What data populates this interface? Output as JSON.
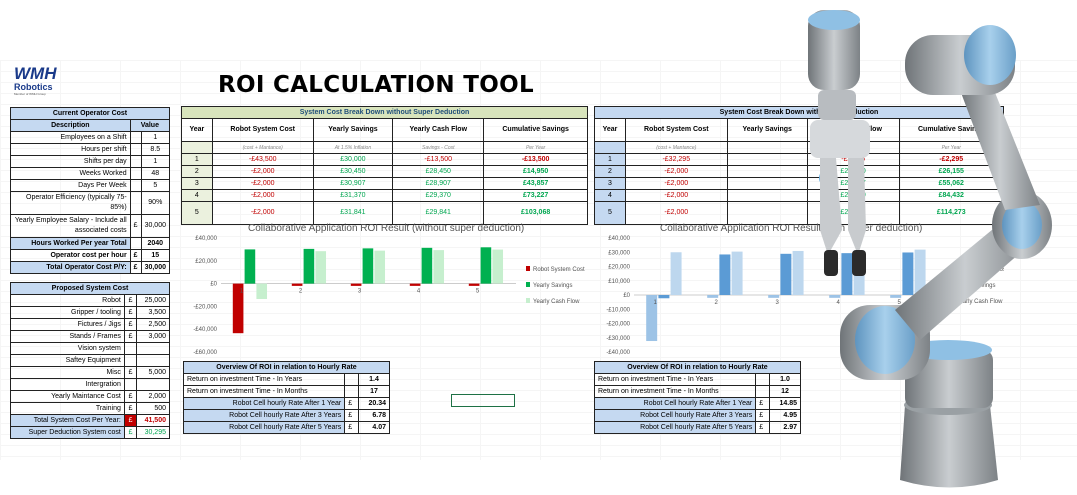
{
  "page_title": "ROI CALCULATION TOOL",
  "logo": {
    "text": "WMH",
    "sub": "Robotics",
    "tag": "Member of WMH Group"
  },
  "operator": {
    "header": "Current Operator Cost",
    "col_desc": "Description",
    "col_val": "Value",
    "rows": [
      {
        "label": "Employees on a Shift",
        "cur": "",
        "value": "1"
      },
      {
        "label": "Hours per shift",
        "cur": "",
        "value": "8.5"
      },
      {
        "label": "Shifts per day",
        "cur": "",
        "value": "1"
      },
      {
        "label": "Weeks Worked",
        "cur": "",
        "value": "48"
      },
      {
        "label": "Days Per Week",
        "cur": "",
        "value": "5"
      },
      {
        "label": "Operator Efficiency (typically 75-85%)",
        "cur": "",
        "value": "90%"
      },
      {
        "label": "Yearly Employee Salary - Include all associated costs",
        "cur": "£",
        "value": "30,000"
      },
      {
        "label": "Hours Worked Per year Total",
        "cur": "",
        "value": "2040"
      },
      {
        "label": "Operator cost per hour",
        "cur": "£",
        "value": "15"
      },
      {
        "label": "Total Operator Cost P/Y:",
        "cur": "£",
        "value": "30,000"
      }
    ]
  },
  "proposed": {
    "header": "Proposed System Cost",
    "rows": [
      {
        "label": "Robot",
        "cur": "£",
        "value": "25,000"
      },
      {
        "label": "Gripper / tooling",
        "cur": "£",
        "value": "3,500"
      },
      {
        "label": "Fictures / Jigs",
        "cur": "£",
        "value": "2,500"
      },
      {
        "label": "Stands / Frames",
        "cur": "£",
        "value": "3,000"
      },
      {
        "label": "Vision system",
        "cur": "",
        "value": ""
      },
      {
        "label": "Saftey Equipment",
        "cur": "",
        "value": ""
      },
      {
        "label": "Misc",
        "cur": "£",
        "value": "5,000"
      },
      {
        "label": "Intergration",
        "cur": "",
        "value": ""
      },
      {
        "label": "Yearly Maintance Cost",
        "cur": "£",
        "value": "2,000"
      },
      {
        "label": "Training",
        "cur": "£",
        "value": "500"
      },
      {
        "label": "Total System Cost Per Year:",
        "cur": "£",
        "value": "41,500"
      },
      {
        "label": "Super Deduction System cost",
        "cur": "£",
        "value": "30,295"
      }
    ]
  },
  "breakdown1": {
    "header": "System Cost Break Down without Super Deduction",
    "cols": [
      "Year",
      "Robot System Cost",
      "Yearly Savings",
      "Yearly Cash Flow",
      "Cumulative Savings"
    ],
    "subs": [
      "",
      "(cost + Mantance)",
      "At 1.5% Inflation",
      "Savings - Cost",
      "Per Year"
    ],
    "rows": [
      [
        "1",
        "-£43,500",
        "£30,000",
        "-£13,500",
        "-£13,500"
      ],
      [
        "2",
        "-£2,000",
        "£30,450",
        "£28,450",
        "£14,950"
      ],
      [
        "3",
        "-£2,000",
        "£30,907",
        "£28,907",
        "£43,857"
      ],
      [
        "4",
        "-£2,000",
        "£31,370",
        "£29,370",
        "£73,227"
      ],
      [
        "5",
        "-£2,000",
        "£31,841",
        "£29,841",
        "£103,068"
      ]
    ]
  },
  "breakdown2": {
    "header": "System Cost Break Down with Super Deduction",
    "cols": [
      "Year",
      "Robot System Cost",
      "Yearly Savings",
      "Yearly Cash Flow",
      "Cumulative Savings"
    ],
    "subs": [
      "",
      "(cost + Mantance)",
      "",
      "Savings - Cost",
      "Per Year"
    ],
    "rows": [
      [
        "1",
        "-£32,295",
        "",
        "-£2,295",
        "-£2,295"
      ],
      [
        "2",
        "-£2,000",
        "",
        "£28,450",
        "£26,155"
      ],
      [
        "3",
        "-£2,000",
        "",
        "£28,907",
        "£55,062"
      ],
      [
        "4",
        "-£2,000",
        "",
        "£29,370",
        "£84,432"
      ],
      [
        "5",
        "-£2,000",
        "",
        "£29,841",
        "£114,273"
      ]
    ]
  },
  "chart_data": [
    {
      "type": "bar",
      "title": "Collaborative Application ROI Result (without super deduction)",
      "categories": [
        "1",
        "2",
        "3",
        "4",
        "5"
      ],
      "ylim": [
        -60000,
        40000
      ],
      "yticks": [
        "£40,000",
        "£20,000",
        "£0",
        "-£20,000",
        "-£40,000",
        "-£60,000"
      ],
      "series": [
        {
          "name": "Robot System Cost",
          "color": "#c00000",
          "values": [
            -43500,
            -2000,
            -2000,
            -2000,
            -2000
          ]
        },
        {
          "name": "Yearly Savings",
          "color": "#00b050",
          "values": [
            30000,
            30450,
            30907,
            31370,
            31841
          ]
        },
        {
          "name": "Yearly Cash Flow",
          "color": "#c6efce",
          "values": [
            -13500,
            28450,
            28907,
            29370,
            29841
          ]
        }
      ]
    },
    {
      "type": "bar",
      "title": "Collaborative Application ROI Result (with super deduction)",
      "categories": [
        "1",
        "2",
        "3",
        "4",
        "5"
      ],
      "ylim": [
        -40000,
        40000
      ],
      "yticks": [
        "£40,000",
        "£30,000",
        "£20,000",
        "£10,000",
        "£0",
        "-£10,000",
        "-£20,000",
        "-£30,000",
        "-£40,000"
      ],
      "series": [
        {
          "name": "Robot System Cost",
          "color": "#9dc3e6",
          "values": [
            -32295,
            -2000,
            -2000,
            -2000,
            -2000
          ]
        },
        {
          "name": "Yearly Savings",
          "color": "#5b9bd5",
          "values": [
            -2295,
            28450,
            28907,
            29370,
            29841
          ]
        },
        {
          "name": "Yearly Cash Flow",
          "color": "#bdd7ee",
          "values": [
            30000,
            30450,
            30907,
            31370,
            31841
          ]
        }
      ]
    }
  ],
  "overview1": {
    "header": "Overview Of ROI in relation to Hourly Rate",
    "rows": [
      {
        "label": "Return on investment Time - In Years",
        "cur": "",
        "value": "1.4"
      },
      {
        "label": "Return on investment Time - In Months",
        "cur": "",
        "value": "17"
      },
      {
        "label": "Robot Cell hourly Rate After 1 Year",
        "cur": "£",
        "value": "20.34"
      },
      {
        "label": "Robot Cell hourly Rate After 3 Years",
        "cur": "£",
        "value": "6.78"
      },
      {
        "label": "Robot Cell hourly Rate After 5 Years",
        "cur": "£",
        "value": "4.07"
      }
    ]
  },
  "overview2": {
    "header": "Overview Of ROI in relation to Hourly Rate",
    "rows": [
      {
        "label": "Return on investment Time - In Years",
        "cur": "",
        "value": "1.0"
      },
      {
        "label": "Return on investment Time - In Months",
        "cur": "",
        "value": "12"
      },
      {
        "label": "Robot Cell hourly Rate After 1 Year",
        "cur": "£",
        "value": "14.85"
      },
      {
        "label": "Robot Cell hourly Rate After 3 Years",
        "cur": "£",
        "value": "4.95"
      },
      {
        "label": "Robot Cell hourly Rate After 5 Years",
        "cur": "£",
        "value": "2.97"
      }
    ]
  }
}
